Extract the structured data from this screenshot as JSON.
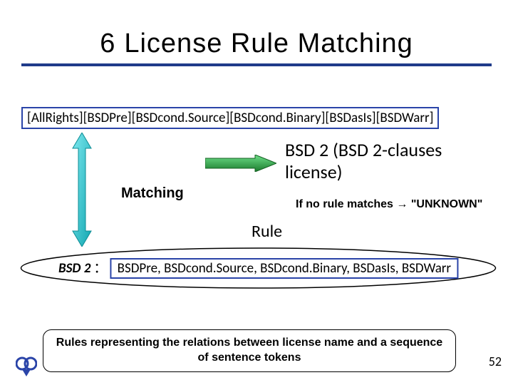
{
  "title": {
    "num": "6",
    "text": "License Rule Matching"
  },
  "sequence": "[AllRights][BSDPre][BSDcond.Source][BSDcond.Binary][BSDasIs][BSDWarr]",
  "labels": {
    "matching": "Matching",
    "rule": "Rule"
  },
  "result": "BSD 2 (BSD 2-clauses license)",
  "no_match": "If no rule matches → \"UNKNOWN\"",
  "rule_def": {
    "name": "BSD 2",
    "sep": "：",
    "tokens": "BSDPre, BSDcond.Source, BSDcond.Binary, BSDasIs, BSDWarr"
  },
  "caption": "Rules representing the relations between license name and a sequence of sentence tokens",
  "page": "52",
  "colors": {
    "rule_border": "#1f3b8a",
    "green": "#249a3c",
    "teal": "#1bbdc7"
  }
}
